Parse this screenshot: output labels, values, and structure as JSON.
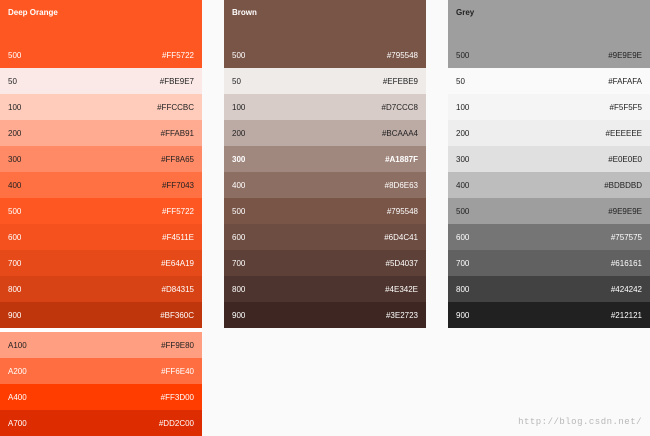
{
  "palettes": [
    {
      "name": "Deep Orange",
      "header": {
        "shade": "500",
        "hex": "#FF5722",
        "bg": "#FF5722",
        "fg": "#ffffff"
      },
      "swatches": [
        {
          "shade": "50",
          "hex": "#FBE9E7",
          "bg": "#FBE9E7",
          "fg": "#222222"
        },
        {
          "shade": "100",
          "hex": "#FFCCBC",
          "bg": "#FFCCBC",
          "fg": "#222222"
        },
        {
          "shade": "200",
          "hex": "#FFAB91",
          "bg": "#FFAB91",
          "fg": "#222222"
        },
        {
          "shade": "300",
          "hex": "#FF8A65",
          "bg": "#FF8A65",
          "fg": "#222222"
        },
        {
          "shade": "400",
          "hex": "#FF7043",
          "bg": "#FF7043",
          "fg": "#222222"
        },
        {
          "shade": "500",
          "hex": "#FF5722",
          "bg": "#FF5722",
          "fg": "#ffffff"
        },
        {
          "shade": "600",
          "hex": "#F4511E",
          "bg": "#F4511E",
          "fg": "#ffffff"
        },
        {
          "shade": "700",
          "hex": "#E64A19",
          "bg": "#E64A19",
          "fg": "#ffffff"
        },
        {
          "shade": "800",
          "hex": "#D84315",
          "bg": "#D84315",
          "fg": "#ffffff"
        },
        {
          "shade": "900",
          "hex": "#BF360C",
          "bg": "#BF360C",
          "fg": "#ffffff"
        }
      ],
      "accents": [
        {
          "shade": "A100",
          "hex": "#FF9E80",
          "bg": "#FF9E80",
          "fg": "#222222"
        },
        {
          "shade": "A200",
          "hex": "#FF6E40",
          "bg": "#FF6E40",
          "fg": "#ffffff"
        },
        {
          "shade": "A400",
          "hex": "#FF3D00",
          "bg": "#FF3D00",
          "fg": "#ffffff"
        },
        {
          "shade": "A700",
          "hex": "#DD2C00",
          "bg": "#DD2C00",
          "fg": "#ffffff"
        }
      ]
    },
    {
      "name": "Brown",
      "header": {
        "shade": "500",
        "hex": "#795548",
        "bg": "#795548",
        "fg": "#ffffff"
      },
      "swatches": [
        {
          "shade": "50",
          "hex": "#EFEBE9",
          "bg": "#EFEBE9",
          "fg": "#222222"
        },
        {
          "shade": "100",
          "hex": "#D7CCC8",
          "bg": "#D7CCC8",
          "fg": "#222222"
        },
        {
          "shade": "200",
          "hex": "#BCAAA4",
          "bg": "#BCAAA4",
          "fg": "#222222"
        },
        {
          "shade": "300",
          "hex": "#A1887F",
          "bg": "#A1887F",
          "fg": "#ffffff",
          "bold": true
        },
        {
          "shade": "400",
          "hex": "#8D6E63",
          "bg": "#8D6E63",
          "fg": "#ffffff"
        },
        {
          "shade": "500",
          "hex": "#795548",
          "bg": "#795548",
          "fg": "#ffffff"
        },
        {
          "shade": "600",
          "hex": "#6D4C41",
          "bg": "#6D4C41",
          "fg": "#ffffff"
        },
        {
          "shade": "700",
          "hex": "#5D4037",
          "bg": "#5D4037",
          "fg": "#ffffff"
        },
        {
          "shade": "800",
          "hex": "#4E342E",
          "bg": "#4E342E",
          "fg": "#ffffff"
        },
        {
          "shade": "900",
          "hex": "#3E2723",
          "bg": "#3E2723",
          "fg": "#ffffff"
        }
      ],
      "accents": []
    },
    {
      "name": "Grey",
      "header": {
        "shade": "500",
        "hex": "#9E9E9E",
        "bg": "#9E9E9E",
        "fg": "#222222"
      },
      "swatches": [
        {
          "shade": "50",
          "hex": "#FAFAFA",
          "bg": "#FAFAFA",
          "fg": "#222222"
        },
        {
          "shade": "100",
          "hex": "#F5F5F5",
          "bg": "#F5F5F5",
          "fg": "#222222"
        },
        {
          "shade": "200",
          "hex": "#EEEEEE",
          "bg": "#EEEEEE",
          "fg": "#222222"
        },
        {
          "shade": "300",
          "hex": "#E0E0E0",
          "bg": "#E0E0E0",
          "fg": "#222222"
        },
        {
          "shade": "400",
          "hex": "#BDBDBD",
          "bg": "#BDBDBD",
          "fg": "#222222"
        },
        {
          "shade": "500",
          "hex": "#9E9E9E",
          "bg": "#9E9E9E",
          "fg": "#222222"
        },
        {
          "shade": "600",
          "hex": "#757575",
          "bg": "#757575",
          "fg": "#ffffff"
        },
        {
          "shade": "700",
          "hex": "#616161",
          "bg": "#616161",
          "fg": "#ffffff"
        },
        {
          "shade": "800",
          "hex": "#424242",
          "bg": "#424242",
          "fg": "#ffffff"
        },
        {
          "shade": "900",
          "hex": "#212121",
          "bg": "#212121",
          "fg": "#ffffff"
        }
      ],
      "accents": []
    }
  ],
  "watermark": "http://blog.csdn.net/"
}
